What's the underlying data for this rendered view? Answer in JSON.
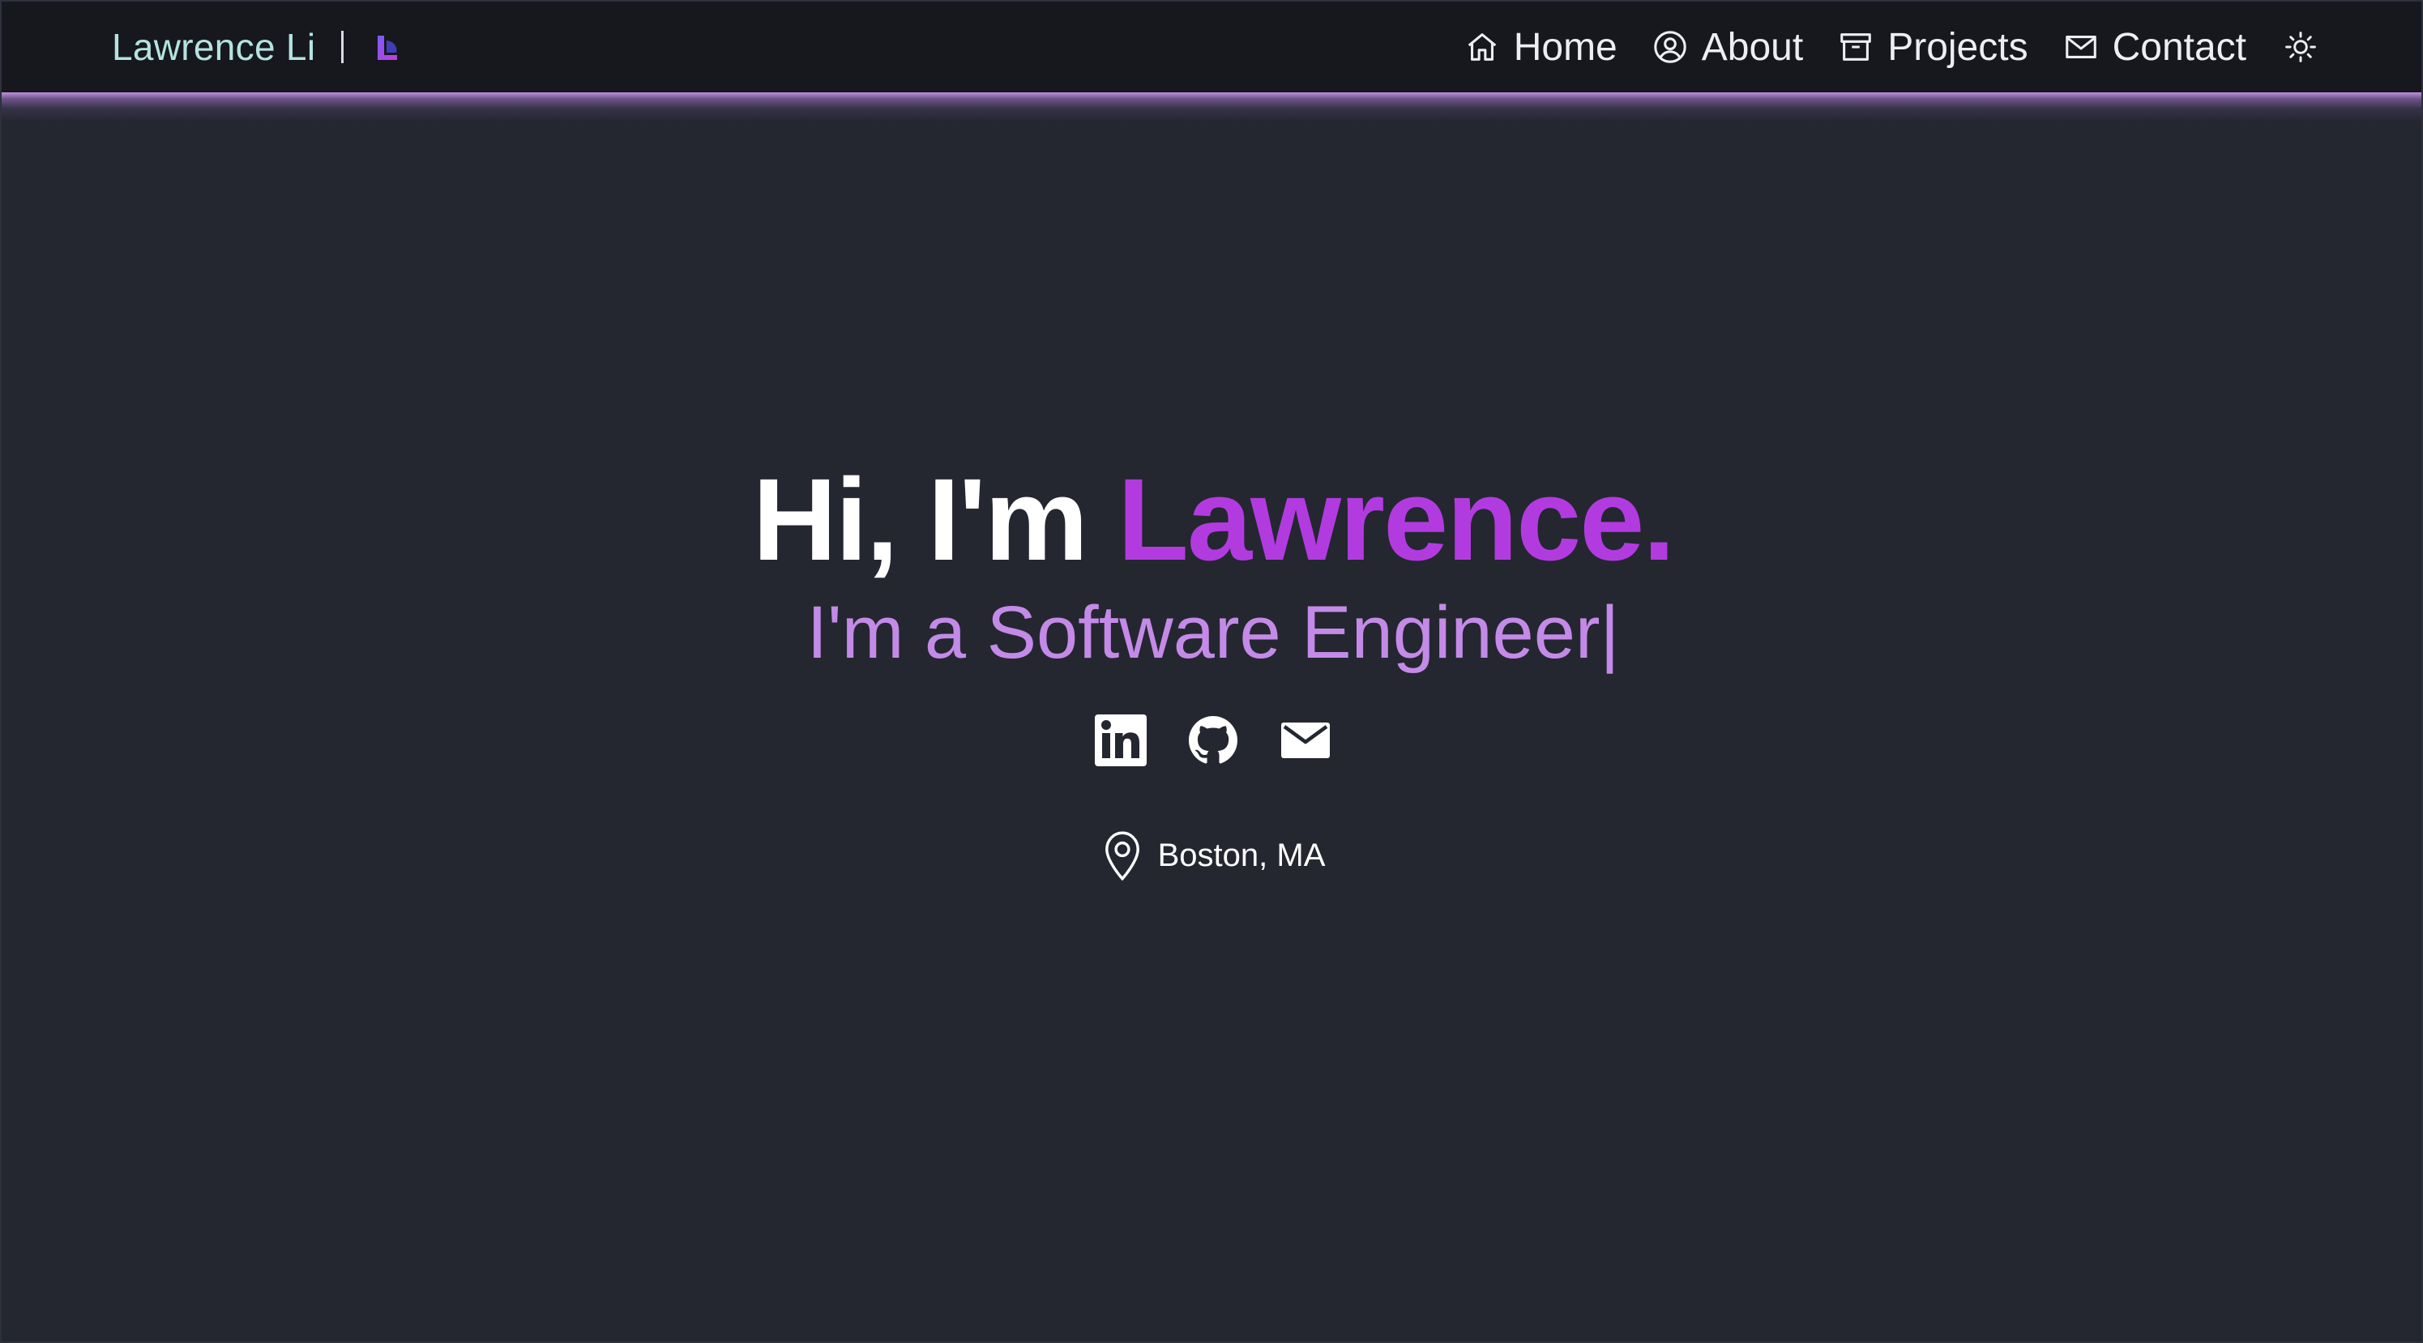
{
  "header": {
    "brand_name": "Lawrence Li",
    "logo_icon": "league-logo-icon",
    "nav": [
      {
        "label": "Home",
        "icon": "home-icon"
      },
      {
        "label": "About",
        "icon": "user-circle-icon"
      },
      {
        "label": "Projects",
        "icon": "archive-icon"
      },
      {
        "label": "Contact",
        "icon": "mail-icon"
      }
    ],
    "theme_toggle_icon": "sun-icon"
  },
  "hero": {
    "greeting": "Hi, I'm ",
    "name": "Lawrence.",
    "subtitle": "I'm a Software Engineer",
    "cursor": "|"
  },
  "socials": [
    {
      "icon": "linkedin-icon"
    },
    {
      "icon": "github-icon"
    },
    {
      "icon": "email-icon"
    }
  ],
  "location": {
    "icon": "map-pin-icon",
    "text": "Boston, MA"
  },
  "colors": {
    "background": "#242730",
    "navbar": "#17181e",
    "brand": "#b4e3df",
    "accent": "#b23be0",
    "subtitle": "#c48ae8",
    "text": "#ffffff"
  }
}
